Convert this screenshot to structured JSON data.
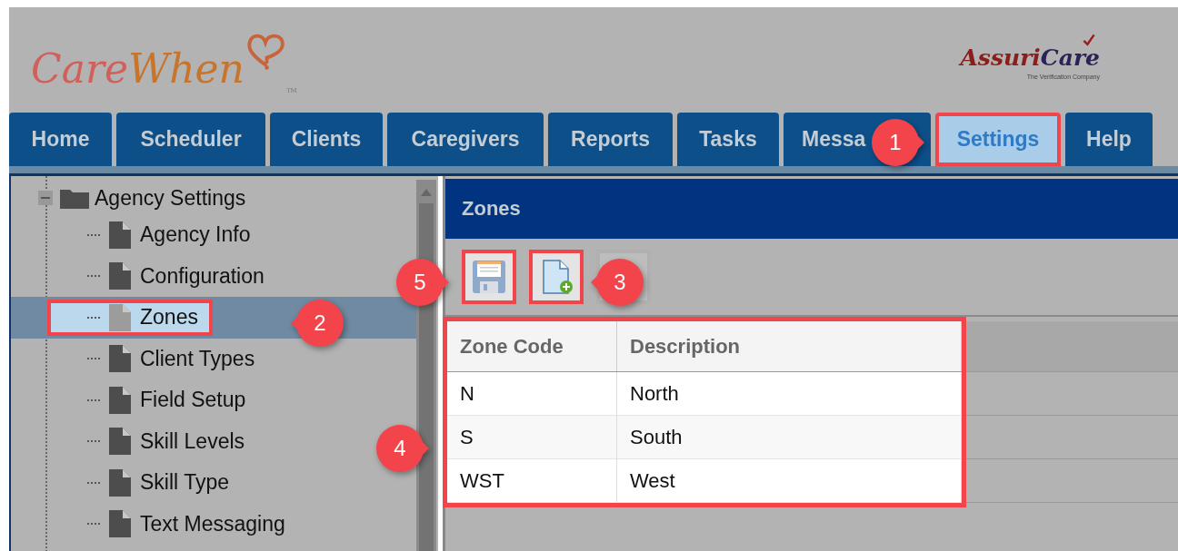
{
  "header": {
    "logo": {
      "part_1": "Care",
      "part_2": "When",
      "trademark": "TM"
    },
    "partner_logo": {
      "part_1": "Assuri",
      "part_2": "Care",
      "tagline": "The Verification Company"
    }
  },
  "tabs": [
    {
      "label": "Home",
      "selected": false,
      "highlighted": false
    },
    {
      "label": "Scheduler",
      "selected": false,
      "highlighted": false
    },
    {
      "label": "Clients",
      "selected": false,
      "highlighted": false
    },
    {
      "label": "Caregivers",
      "selected": false,
      "highlighted": false
    },
    {
      "label": "Reports",
      "selected": false,
      "highlighted": false
    },
    {
      "label": "Tasks",
      "selected": false,
      "highlighted": false
    },
    {
      "label": "Messa",
      "selected": false,
      "highlighted": false
    },
    {
      "label": "Settings",
      "selected": true,
      "highlighted": true
    },
    {
      "label": "Help",
      "selected": false,
      "highlighted": false
    }
  ],
  "tree": [
    {
      "label": "Agency Settings",
      "expanded": true,
      "children": [
        {
          "label": "Agency Info",
          "selected": false,
          "highlighted": false
        },
        {
          "label": "Configuration",
          "selected": false,
          "highlighted": false
        },
        {
          "label": "Zones",
          "selected": true,
          "highlighted": true
        },
        {
          "label": "Client Types",
          "selected": false,
          "highlighted": false
        },
        {
          "label": "Field Setup",
          "selected": false,
          "highlighted": false
        },
        {
          "label": "Skill Levels",
          "selected": false,
          "highlighted": false
        },
        {
          "label": "Skill Type",
          "selected": false,
          "highlighted": false
        },
        {
          "label": "Text Messaging",
          "selected": false,
          "highlighted": false
        }
      ]
    }
  ],
  "panel": {
    "title": "Zones",
    "toolbar": [
      {
        "kind": "save",
        "disabled": false,
        "highlighted": true
      },
      {
        "kind": "new",
        "disabled": false,
        "highlighted": true
      },
      {
        "kind": "delete",
        "disabled": true,
        "highlighted": false
      }
    ],
    "table": {
      "highlighted": true,
      "columns": [
        "Zone Code",
        "Description"
      ],
      "rows": [
        [
          "N",
          "North"
        ],
        [
          "S",
          "South"
        ],
        [
          "WST",
          "West"
        ]
      ]
    }
  },
  "callouts": [
    {
      "number": "1"
    },
    {
      "number": "5"
    },
    {
      "number": "3"
    },
    {
      "number": "2"
    },
    {
      "number": "4"
    }
  ]
}
